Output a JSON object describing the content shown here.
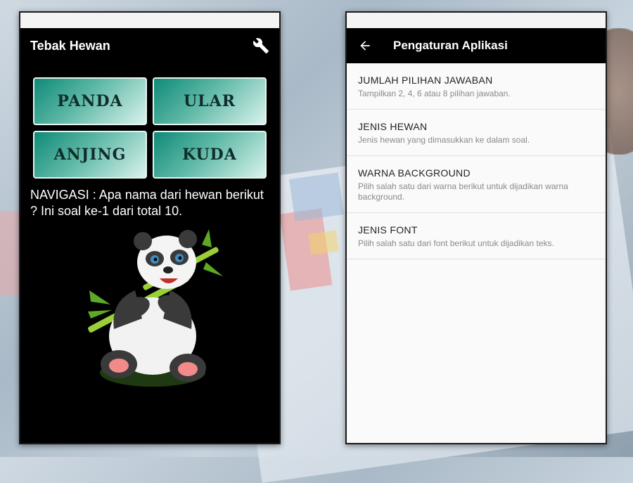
{
  "quiz_app": {
    "title": "Tebak Hewan",
    "answers": [
      "PANDA",
      "ULAR",
      "ANJING",
      "KUDA"
    ],
    "question": "NAVIGASI : Apa nama dari hewan berikut ? Ini soal ke-1 dari total 10.",
    "icons": {
      "settings": "wrench-icon",
      "image": "panda-image"
    },
    "colors": {
      "background": "#000000",
      "button_gradient_start": "#0f8a78",
      "button_gradient_end": "#d9f2ec"
    }
  },
  "settings_app": {
    "title": "Pengaturan Aplikasi",
    "back_icon": "arrow-left-icon",
    "items": [
      {
        "title": "JUMLAH PILIHAN JAWABAN",
        "summary": "Tampilkan 2, 4, 6 atau 8 pilihan jawaban."
      },
      {
        "title": "JENIS HEWAN",
        "summary": "Jenis hewan yang dimasukkan ke dalam soal."
      },
      {
        "title": "WARNA BACKGROUND",
        "summary": "Pilih salah satu dari warna berikut untuk dijadikan warna background."
      },
      {
        "title": "JENIS FONT",
        "summary": "Pilih salah satu dari font berikut untuk dijadikan teks."
      }
    ]
  }
}
